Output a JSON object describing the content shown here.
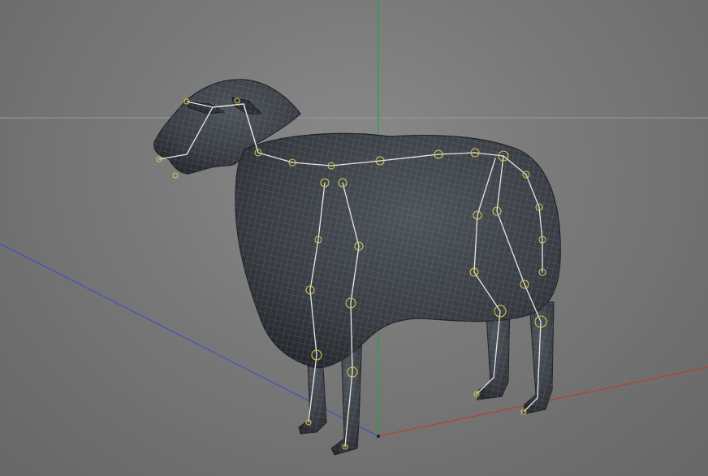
{
  "viewport": {
    "background": "#7a7a7a",
    "object": "sheep-mesh-with-skeleton-rig"
  },
  "axes": {
    "x_color": "#c0392b",
    "y_color": "#2ea043",
    "z_color": "#3b4fc9",
    "horizon_color": "#9a9a9a"
  },
  "mesh": {
    "fill": "#3e4248",
    "wire": "#9aa4ae"
  },
  "rig": {
    "bone_color": "#e6e6e6",
    "joint_color": "#d4c64a"
  },
  "icons": [
    "green-y-axis-icon",
    "red-x-axis-icon",
    "blue-z-axis-icon"
  ]
}
